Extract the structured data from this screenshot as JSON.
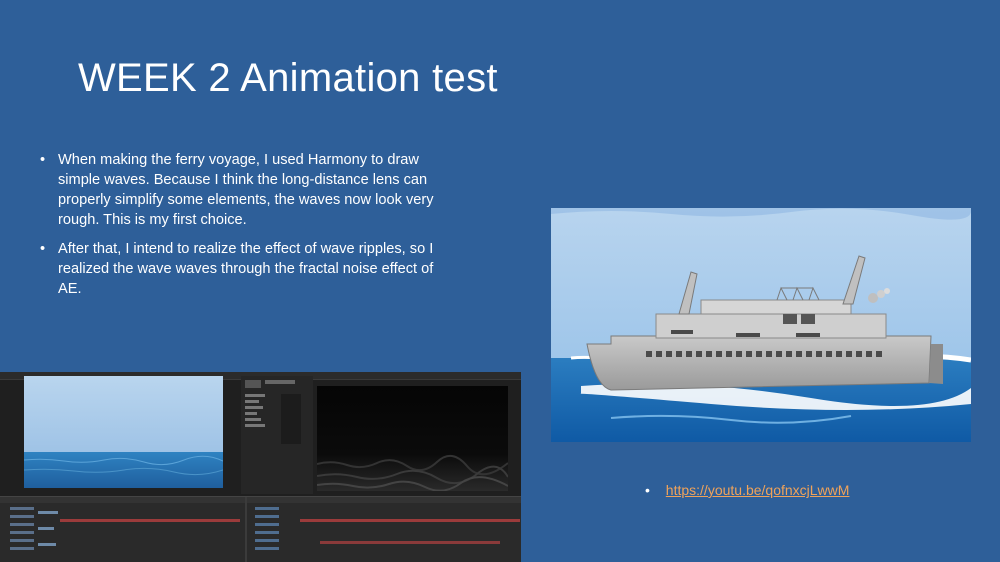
{
  "slide": {
    "title": "WEEK 2 Animation test",
    "bullets": [
      "When making the ferry voyage, I used Harmony to draw simple waves. Because I think the long-distance lens can properly simplify some elements, the waves now look very rough. This is my first choice.",
      "After that, I intend to realize the effect of wave ripples, so I realized the wave waves through the fractal noise effect of AE."
    ],
    "bullet_glyph": "•",
    "link": {
      "text": "https://youtu.be/qofnxcjLwwM"
    }
  },
  "colors": {
    "background": "#2e5f99",
    "text": "#ffffff",
    "link": "#f0a35a"
  }
}
